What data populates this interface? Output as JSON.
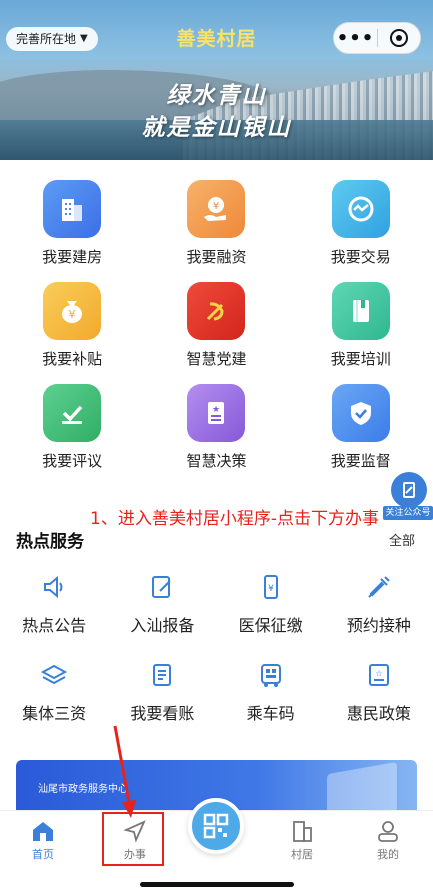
{
  "header": {
    "location_label": "完善所在地",
    "app_title": "善美村居",
    "slogan_line1": "绿水青山",
    "slogan_line2": "就是金山银山"
  },
  "grid": [
    {
      "label": "我要建房",
      "icon": "building-icon",
      "color": "#4f86f0"
    },
    {
      "label": "我要融资",
      "icon": "yuan-hand-icon",
      "color": "#f19a4c"
    },
    {
      "label": "我要交易",
      "icon": "exchange-icon",
      "color": "#3fb6e8"
    },
    {
      "label": "我要补贴",
      "icon": "money-bag-icon",
      "color": "#f5b93d"
    },
    {
      "label": "智慧党建",
      "icon": "party-emblem-icon",
      "color": "#e0352a"
    },
    {
      "label": "我要培训",
      "icon": "book-icon",
      "color": "#3cc6a2"
    },
    {
      "label": "我要评议",
      "icon": "approve-icon",
      "color": "#3dbf79"
    },
    {
      "label": "智慧决策",
      "icon": "document-star-icon",
      "color": "#9a6fe3"
    },
    {
      "label": "我要监督",
      "icon": "shield-check-icon",
      "color": "#4a8ff0"
    }
  ],
  "float_follow": {
    "label": "关注公众号"
  },
  "annotation": {
    "text": "1、进入善美村居小程序-点击下方办事"
  },
  "hot_services": {
    "title": "热点服务",
    "all_label": "全部",
    "items": [
      {
        "label": "热点公告",
        "icon": "megaphone-icon"
      },
      {
        "label": "入汕报备",
        "icon": "edit-form-icon"
      },
      {
        "label": "医保征缴",
        "icon": "phone-yuan-icon"
      },
      {
        "label": "预约接种",
        "icon": "syringe-icon"
      },
      {
        "label": "集体三资",
        "icon": "layers-icon"
      },
      {
        "label": "我要看账",
        "icon": "ledger-icon"
      },
      {
        "label": "乘车码",
        "icon": "bus-qr-icon"
      },
      {
        "label": "惠民政策",
        "icon": "policy-doc-icon"
      }
    ]
  },
  "promo": {
    "org_label": "汕尾市政务服务中心"
  },
  "tabbar": {
    "home": "首页",
    "ban": "办事",
    "village": "村居",
    "mine": "我的"
  },
  "colors": {
    "accent": "#3a7fd8",
    "annotation": "#e8231d",
    "title_yellow": "#f7e26b"
  }
}
